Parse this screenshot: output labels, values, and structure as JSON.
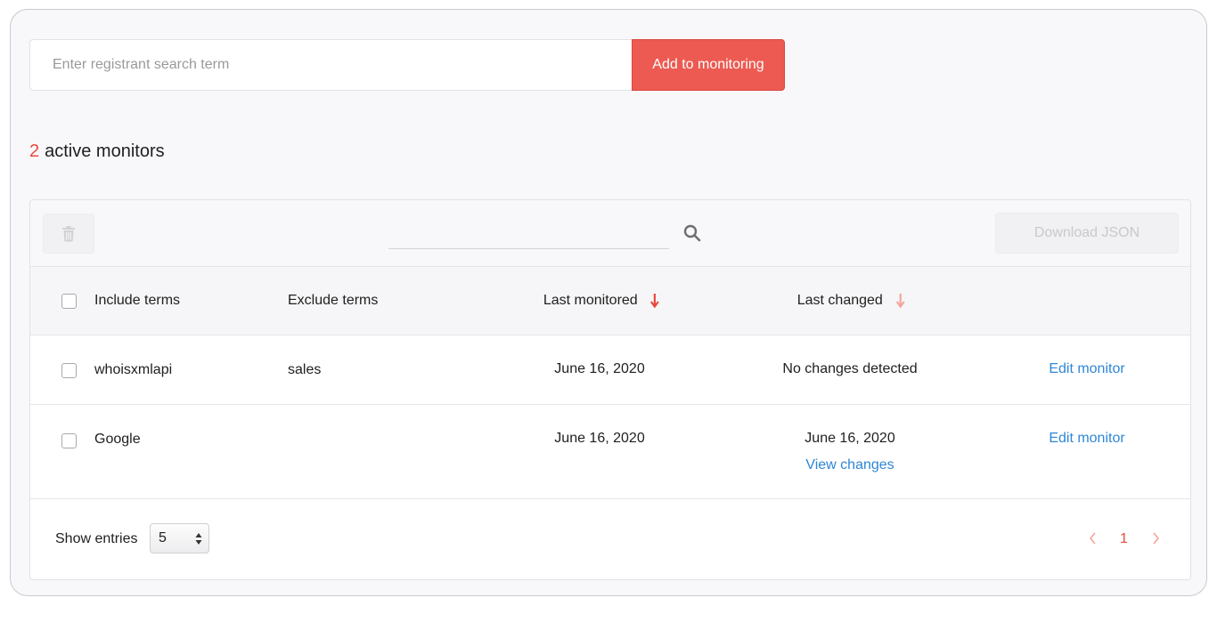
{
  "add_bar": {
    "placeholder": "Enter registrant search term",
    "add_label": "Add to monitoring"
  },
  "summary": {
    "count": "2",
    "label": "active monitors"
  },
  "toolbar": {
    "delete_icon": "trash-icon",
    "search_icon": "search-icon",
    "search_value": "",
    "download_label": "Download JSON"
  },
  "table": {
    "headers": {
      "include": "Include terms",
      "exclude": "Exclude terms",
      "last_monitored": "Last monitored",
      "last_changed": "Last changed"
    },
    "sort_icon": "arrow-down-icon",
    "rows": [
      {
        "include": "whoisxmlapi",
        "exclude": "sales",
        "last_monitored": "June 16, 2020",
        "last_changed": "No changes detected",
        "view_changes": "",
        "action": "Edit monitor"
      },
      {
        "include": "Google",
        "exclude": "",
        "last_monitored": "June 16, 2020",
        "last_changed": "June 16, 2020",
        "view_changes": "View changes",
        "action": "Edit monitor"
      }
    ]
  },
  "footer": {
    "show_entries_label": "Show entries",
    "entries_value": "5",
    "current_page": "1",
    "prev_icon": "chevron-left-icon",
    "next_icon": "chevron-right-icon"
  },
  "colors": {
    "accent": "#ec5a51",
    "link": "#2f86d6",
    "count": "#e84a3f"
  }
}
